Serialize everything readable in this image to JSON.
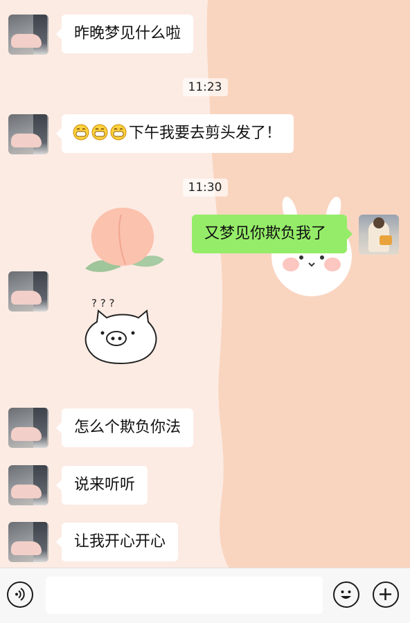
{
  "messages": [
    {
      "side": "left",
      "type": "text",
      "text": "昨晚梦见什么啦"
    },
    {
      "type": "time",
      "text": "11:23"
    },
    {
      "side": "left",
      "type": "text",
      "emoji": [
        "grin-icon",
        "grin-icon",
        "grin-icon"
      ],
      "text": "下午我要去剪头发了！"
    },
    {
      "type": "time",
      "text": "11:30"
    },
    {
      "side": "right",
      "type": "text",
      "text": "又梦见你欺负我了"
    },
    {
      "side": "left",
      "type": "sticker",
      "icon": "confused-pig-sticker",
      "text": "? ? ?"
    },
    {
      "side": "left",
      "type": "text",
      "text": "怎么个欺负你法"
    },
    {
      "side": "left",
      "type": "text",
      "text": "说来听听"
    },
    {
      "side": "left",
      "type": "text",
      "text": "让我开心开心"
    }
  ],
  "input": {
    "value": ""
  },
  "toolbar": {
    "voice_icon": "voice-icon",
    "emoji_icon": "emoji-icon",
    "plus_icon": "plus-icon"
  },
  "colors": {
    "sent_bubble": "#95ec69",
    "received_bubble": "#ffffff",
    "wallpaper_left": "#fcebe3",
    "wallpaper_right": "#f8d3bd"
  }
}
